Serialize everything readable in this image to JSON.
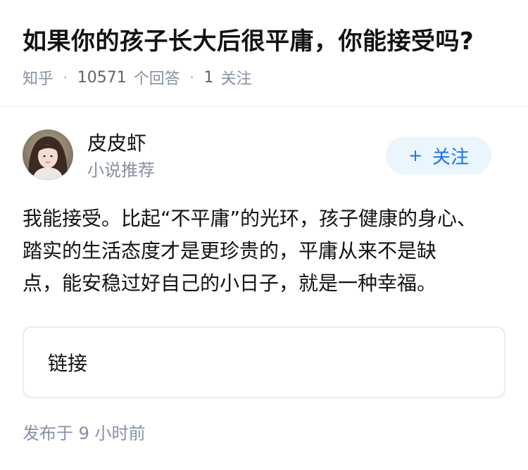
{
  "question": {
    "title": "如果你的孩子长大后很平庸，你能接受吗?"
  },
  "meta": {
    "source": "知乎",
    "separator": "·",
    "answer_count": "10571",
    "answer_label": "个回答",
    "follow_count": "1",
    "follow_label": "关注"
  },
  "author": {
    "name": "皮皮虾",
    "bio": "小说推荐",
    "follow_button": {
      "icon": "+",
      "label": "关注"
    }
  },
  "answer": {
    "line1": "我能接受。比起“不平庸”的光环，孩子健康的身心、",
    "line2": "踏实的生活态度才是更珍贵的，平庸从来不是缺",
    "line3": "点，能安稳过好自己的小日子，就是一种幸福。"
  },
  "link_card": {
    "label": "链接"
  },
  "footer": {
    "published_prefix": "发布于",
    "published_time": "9 小时前"
  },
  "colors": {
    "accent": "#1772f6",
    "follow_bg": "#ebf5fd",
    "meta_gray": "#8590a6",
    "text": "#121212"
  },
  "icons": {
    "avatar": "girl-portrait-avatar",
    "follow": "plus-icon"
  }
}
